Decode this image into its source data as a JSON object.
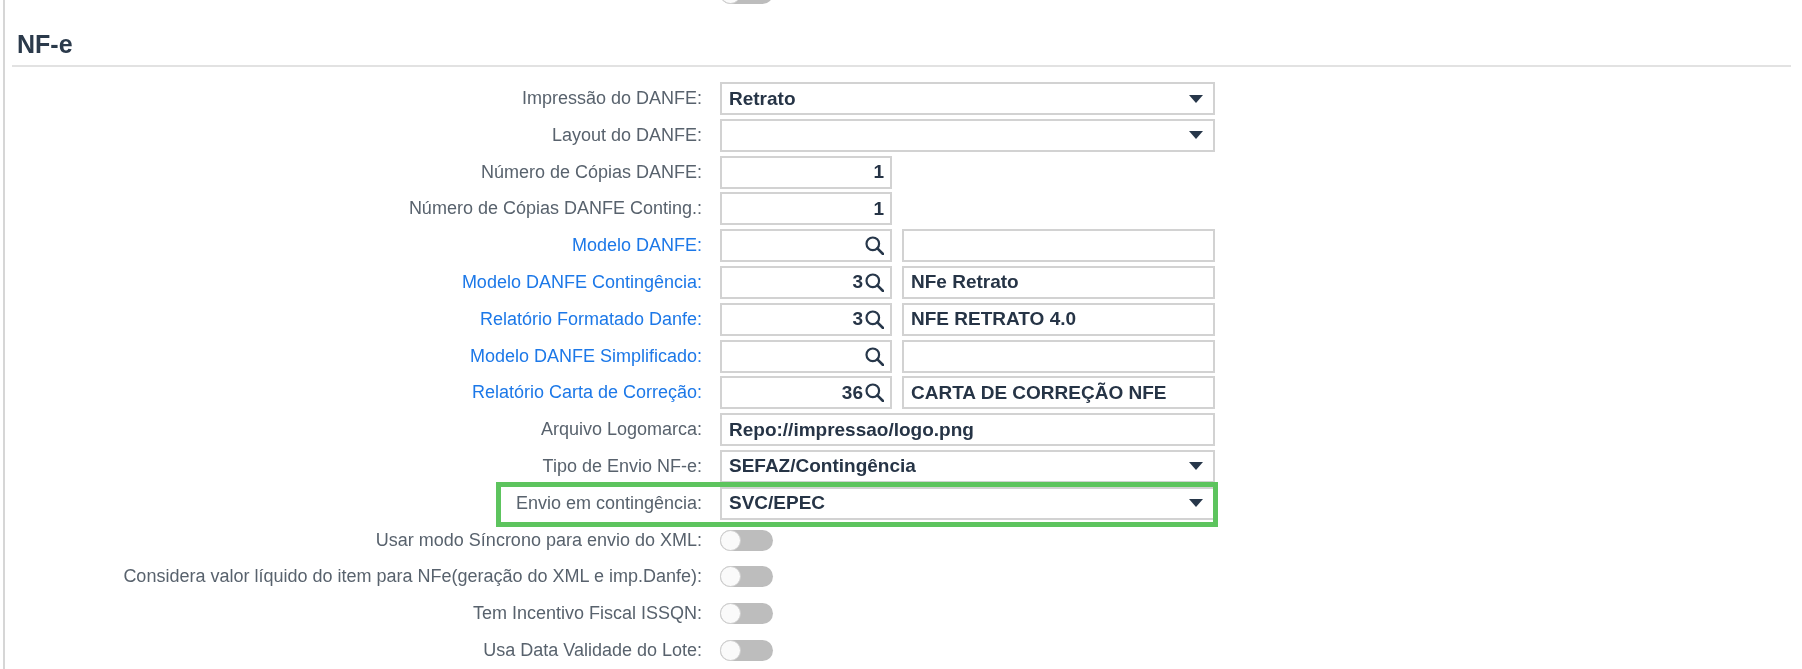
{
  "clipped_row": {
    "on": false
  },
  "section": {
    "title": "NF-e"
  },
  "fields": [
    {
      "kind": "select",
      "label": "Impressão do DANFE:",
      "link": false,
      "highlighted": false,
      "value": "Retrato"
    },
    {
      "kind": "select",
      "label": "Layout do DANFE:",
      "link": false,
      "highlighted": false
    },
    {
      "kind": "number",
      "label": "Número de Cópias DANFE:",
      "link": false,
      "highlighted": false,
      "value": "1"
    },
    {
      "kind": "number",
      "label": "Número de Cópias DANFE Conting.:",
      "link": false,
      "highlighted": false,
      "value": "1"
    },
    {
      "kind": "lookup",
      "label": "Modelo DANFE:",
      "link": true,
      "highlighted": false
    },
    {
      "kind": "lookup",
      "label": "Modelo DANFE Contingência:",
      "link": true,
      "highlighted": false,
      "code": "3",
      "description": "NFe Retrato"
    },
    {
      "kind": "lookup",
      "label": "Relatório Formatado Danfe:",
      "link": true,
      "highlighted": false,
      "code": "3",
      "description": "NFE RETRATO 4.0"
    },
    {
      "kind": "lookup",
      "label": "Modelo DANFE Simplificado:",
      "link": true,
      "highlighted": false
    },
    {
      "kind": "lookup",
      "label": "Relatório Carta de Correção:",
      "link": true,
      "highlighted": false,
      "code": "36",
      "description": "CARTA DE CORREÇÃO NFE"
    },
    {
      "kind": "text",
      "label": "Arquivo Logomarca:",
      "link": false,
      "highlighted": false,
      "value": "Repo://impressao/logo.png"
    },
    {
      "kind": "select",
      "label": "Tipo de Envio NF-e:",
      "link": false,
      "highlighted": false,
      "value": "SEFAZ/Contingência"
    },
    {
      "kind": "select",
      "label": "Envio em contingência:",
      "link": false,
      "highlighted": true,
      "value": "SVC/EPEC"
    },
    {
      "kind": "toggle",
      "label": "Usar modo Síncrono para envio do XML:",
      "link": false,
      "highlighted": false,
      "on": false
    },
    {
      "kind": "toggle",
      "label": "Considera valor líquido do item para NFe(geração do XML e imp.Danfe):",
      "link": false,
      "highlighted": false,
      "on": false
    },
    {
      "kind": "toggle",
      "label": "Tem Incentivo Fiscal ISSQN:",
      "link": false,
      "highlighted": false,
      "on": false
    },
    {
      "kind": "toggle",
      "label": "Usa Data Validade do Lote:",
      "link": false,
      "highlighted": false,
      "on": false
    }
  ]
}
